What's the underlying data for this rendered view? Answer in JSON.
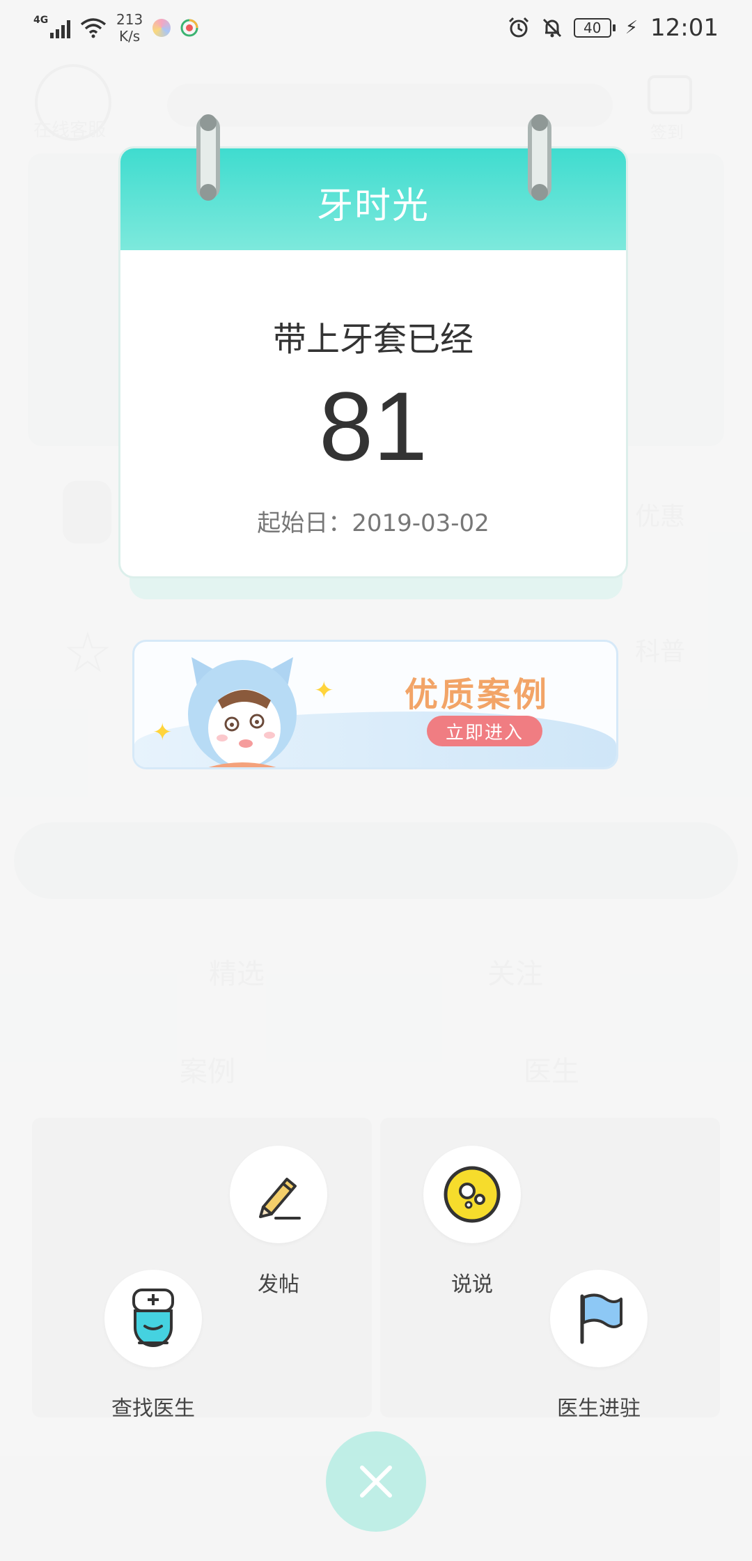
{
  "status_bar": {
    "network_type": "4G",
    "net_speed_value": "213",
    "net_speed_unit": "K/s",
    "battery_level": "40",
    "time": "12:01"
  },
  "calendar": {
    "title": "牙时光",
    "label": "带上牙套已经",
    "days": "81",
    "start_date_text": "起始日：2019-03-02"
  },
  "promo": {
    "title": "优质案例",
    "button_label": "立即进入"
  },
  "actions": {
    "post_label": "发帖",
    "talk_label": "说说",
    "find_doctor_label": "查找医生",
    "doctor_join_label": "医生进驻"
  },
  "background": {
    "service_label": "在线客服",
    "checkin_label": "签到",
    "discount_label": "优惠",
    "science_label": "科普",
    "tab_labels": [
      "精选",
      "关注",
      "案例",
      "医生"
    ]
  },
  "colors": {
    "accent": "#3fdccf",
    "promo_title": "#f2a467",
    "promo_button": "#f07d82",
    "close_button": "#bfeee6"
  }
}
